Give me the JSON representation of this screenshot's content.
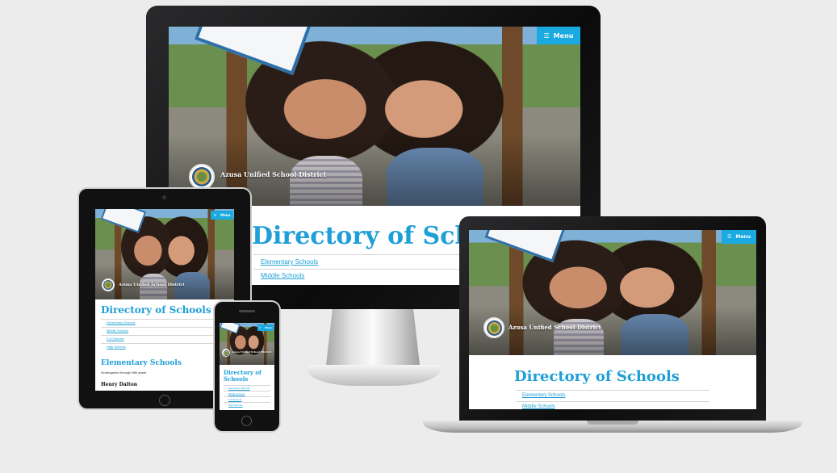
{
  "site": {
    "name": "Azusa Unified School District",
    "menu_label": "Menu",
    "page_title": "Directory of Schools",
    "links": [
      "Elementary Schools",
      "Middle Schools",
      "K-8 Schools",
      "High Schools"
    ],
    "section_heading": "Elementary Schools",
    "section_subtitle": "Kindergarten through fifth grade",
    "first_school": "Henry Dalton"
  },
  "devices": [
    "desktop-monitor",
    "tablet",
    "phone",
    "laptop"
  ],
  "colors": {
    "accent": "#1aa9e0",
    "heading": "#1e9fd6",
    "background": "#ececec"
  },
  "icons": {
    "menu": "hamburger-icon",
    "logo": "district-seal-icon"
  }
}
